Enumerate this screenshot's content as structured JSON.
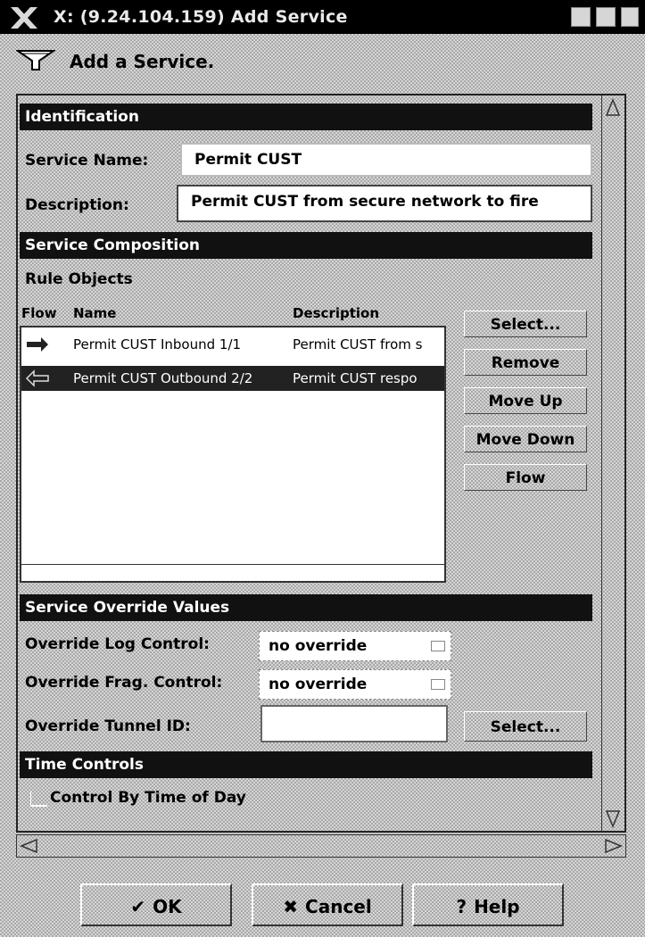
{
  "window": {
    "title": "X: (9.24.104.159) Add Service",
    "heading": "Add a Service."
  },
  "identification": {
    "section_title": "Identification",
    "service_name_label": "Service Name:",
    "service_name_value": "Permit CUST",
    "description_label": "Description:",
    "description_value": "Permit CUST from secure network to fire"
  },
  "composition": {
    "section_title": "Service Composition",
    "rule_objects_label": "Rule Objects",
    "columns": {
      "flow": "Flow",
      "name": "Name",
      "description": "Description"
    },
    "rows": [
      {
        "flow_icon": "inbound-arrow-icon",
        "name": "Permit CUST Inbound 1/1",
        "description": "Permit CUST from s",
        "selected": false
      },
      {
        "flow_icon": "outbound-arrow-icon",
        "name": "Permit CUST Outbound 2/2",
        "description": "Permit CUST respo",
        "selected": true
      }
    ],
    "buttons": {
      "select": "Select...",
      "remove": "Remove",
      "move_up": "Move Up",
      "move_down": "Move Down",
      "flow": "Flow"
    }
  },
  "override": {
    "section_title": "Service Override Values",
    "log_label": "Override Log Control:",
    "log_value": "no override",
    "frag_label": "Override Frag. Control:",
    "frag_value": "no override",
    "tunnel_label": "Override Tunnel ID:",
    "tunnel_value": "",
    "select_button": "Select..."
  },
  "time": {
    "section_title": "Time Controls",
    "checkbox_label": "Control By Time of Day",
    "checked": false
  },
  "footer": {
    "ok": "OK",
    "cancel": "Cancel",
    "help": "Help"
  }
}
